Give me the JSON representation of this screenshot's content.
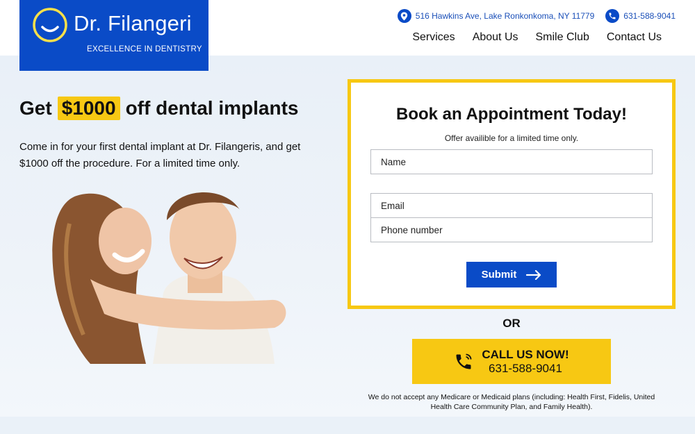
{
  "brand": {
    "name": "Dr. Filangeri",
    "tagline": "EXCELLENCE IN DENTISTRY",
    "color_primary": "#0a4bc7",
    "color_accent": "#f7c813"
  },
  "header": {
    "address": "516 Hawkins Ave, Lake Ronkonkoma, NY 11779",
    "phone": "631-588-9041",
    "address_icon": "map-pin-icon",
    "phone_icon": "phone-icon",
    "nav": [
      {
        "label": "Services"
      },
      {
        "label": "About Us"
      },
      {
        "label": "Smile Club"
      },
      {
        "label": "Contact Us"
      }
    ]
  },
  "hero": {
    "headline_pre": "Get",
    "headline_highlight": "$1000",
    "headline_post": "off dental implants",
    "subcopy": "Come in for your first dental implant at Dr. Filangeris, and get $1000 off the procedure. For a limited time only."
  },
  "form": {
    "title": "Book an Appointment Today!",
    "subtitle": "Offer availible for a limited time only.",
    "name_placeholder": "Name",
    "email_placeholder": "Email",
    "phone_placeholder": "Phone number",
    "submit_label": "Submit",
    "submit_icon": "arrow-right-icon"
  },
  "or_text": "OR",
  "call": {
    "label": "CALL US NOW!",
    "number": "631-588-9041",
    "icon": "phone-icon"
  },
  "disclaimer": "We do not accept any Medicare or Medicaid plans (including: Health First, Fidelis, United Health Care Community Plan, and Family Health)."
}
